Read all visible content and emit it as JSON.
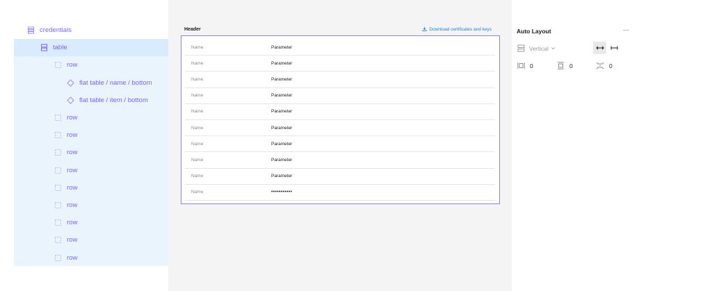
{
  "layers": {
    "items": [
      {
        "label": "credentials",
        "icon": "frame-stack-icon"
      },
      {
        "label": "table",
        "icon": "auto-layout-vertical-icon"
      },
      {
        "label": "row",
        "icon": "frame-dashed-icon"
      },
      {
        "label": "flat table / name / bottom",
        "icon": "component-instance-icon"
      },
      {
        "label": "flat table / item / bottom",
        "icon": "component-instance-icon"
      },
      {
        "label": "row",
        "icon": "frame-dashed-icon"
      },
      {
        "label": "row",
        "icon": "frame-dashed-icon"
      },
      {
        "label": "row",
        "icon": "frame-dashed-icon"
      },
      {
        "label": "row",
        "icon": "frame-dashed-icon"
      },
      {
        "label": "row",
        "icon": "frame-dashed-icon"
      },
      {
        "label": "row",
        "icon": "frame-dashed-icon"
      },
      {
        "label": "row",
        "icon": "frame-dashed-icon"
      },
      {
        "label": "row",
        "icon": "frame-dashed-icon"
      },
      {
        "label": "row",
        "icon": "frame-dashed-icon"
      }
    ],
    "selected_index": 1
  },
  "canvas": {
    "header": "Header",
    "download_label": "Download certificates and keys",
    "rows": [
      {
        "name": "Name",
        "value": "Parameter"
      },
      {
        "name": "Name",
        "value": "Parameter"
      },
      {
        "name": "Name",
        "value": "Parameter"
      },
      {
        "name": "Name",
        "value": "Parameter"
      },
      {
        "name": "Name",
        "value": "Parameter"
      },
      {
        "name": "Name",
        "value": "Parameter"
      },
      {
        "name": "Name",
        "value": "Parameter"
      },
      {
        "name": "Name",
        "value": "Parameter"
      },
      {
        "name": "Name",
        "value": "Parameter"
      },
      {
        "name": "Name",
        "value": "•••••••••••"
      }
    ]
  },
  "properties": {
    "title": "Auto Layout",
    "direction": "Vertical",
    "padding_horizontal": "0",
    "padding_vertical": "0",
    "item_spacing": "0"
  },
  "colors": {
    "accent": "#7b61ff",
    "selected_bg": "#d9ecff",
    "children_bg": "#eaf4fd",
    "frame_border": "#8c7cf5",
    "link": "#1b7fd4",
    "canvas_bg": "#f4f4f4"
  }
}
